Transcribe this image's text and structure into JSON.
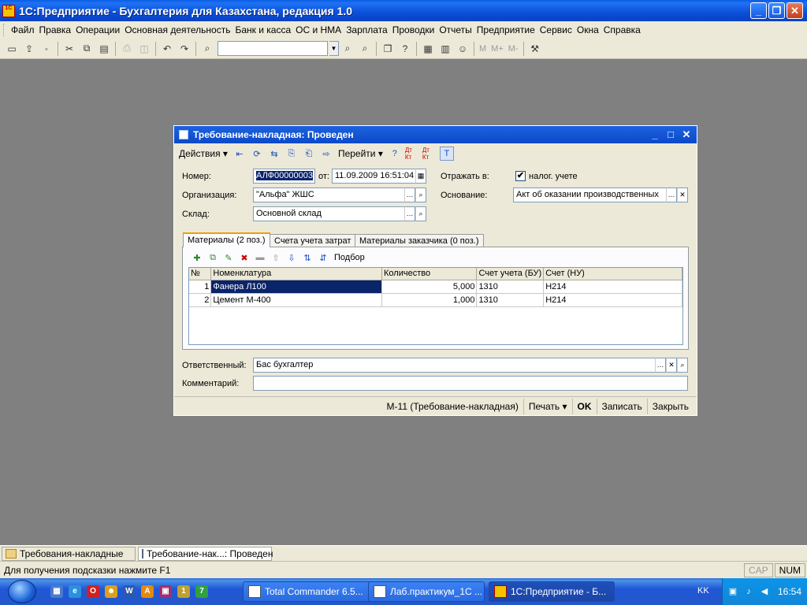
{
  "app": {
    "title": "1С:Предприятие - Бухгалтерия для Казахстана, редакция 1.0",
    "icon_text": "1С"
  },
  "menu": [
    "Файл",
    "Правка",
    "Операции",
    "Основная деятельность",
    "Банк и касса",
    "ОС и НМА",
    "Зарплата",
    "Проводки",
    "Отчеты",
    "Предприятие",
    "Сервис",
    "Окна",
    "Справка"
  ],
  "toolbar": {
    "m_labels": [
      "M",
      "M+",
      "M-"
    ]
  },
  "document": {
    "title": "Требование-накладная: Проведен",
    "toolbar": {
      "actions": "Действия",
      "goto": "Перейти",
      "help": "?",
      "dt_kt_1": "Дт Кт",
      "dt_kt_2": "Дт Кт"
    },
    "fields": {
      "number_label": "Номер:",
      "number_value": "АЛФ00000003",
      "date_label": "от:",
      "date_value": "11.09.2009 16:51:04",
      "reflect_label": "Отражать в:",
      "tax_label": "налог. учете",
      "tax_checked": "✔",
      "org_label": "Организация:",
      "org_value": "\"Альфа\" ЖШС",
      "basis_label": "Основание:",
      "basis_value": "Акт об оказании производственных",
      "warehouse_label": "Склад:",
      "warehouse_value": "Основной склад",
      "responsible_label": "Ответственный:",
      "responsible_value": "Бас бухгалтер",
      "comment_label": "Комментарий:",
      "comment_value": ""
    },
    "tabs": [
      "Материалы (2 поз.)",
      "Счета учета затрат",
      "Материалы заказчика (0 поз.)"
    ],
    "table_toolbar": {
      "pick": "Подбор"
    },
    "table": {
      "columns": [
        "№",
        "Номенклатура",
        "Количество",
        "Счет учета (БУ)",
        "Счет (НУ)"
      ],
      "rows": [
        {
          "n": "1",
          "item": "Фанера Л100",
          "qty": "5,000",
          "acc_bu": "1310",
          "acc_nu": "Н214"
        },
        {
          "n": "2",
          "item": "Цемент М-400",
          "qty": "1,000",
          "acc_bu": "1310",
          "acc_nu": "Н214"
        }
      ]
    },
    "footer": {
      "print_form": "М-11 (Требование-накладная)",
      "print": "Печать",
      "ok": "OK",
      "save": "Записать",
      "close": "Закрыть"
    }
  },
  "window_tabs": [
    "Требования-накладные",
    "Требование-нак...: Проведен"
  ],
  "status": {
    "hint": "Для получения подсказки нажмите F1",
    "cap": "CAP",
    "num": "NUM"
  },
  "taskbar": {
    "tasks": [
      "Total Commander 6.5...",
      "Лаб.практикум_1С ...",
      "1С:Предприятие - Б..."
    ],
    "lang": "KK",
    "clock": "16:54"
  }
}
